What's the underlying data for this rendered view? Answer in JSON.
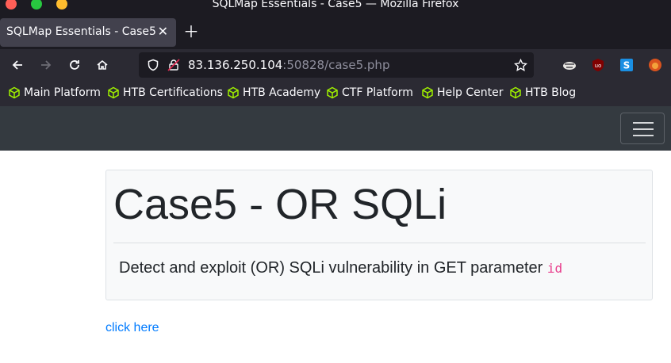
{
  "window": {
    "title": "SQLMap Essentials - Case5 — Mozilla Firefox"
  },
  "tabs": [
    {
      "label": "SQLMap Essentials - Case5"
    }
  ],
  "toolbar": {
    "url_host": "83.136.250.104",
    "url_rest": ":50828/case5.php"
  },
  "bookmarks": [
    {
      "label": "Main Platform"
    },
    {
      "label": "HTB Certifications"
    },
    {
      "label": "HTB Academy"
    },
    {
      "label": "CTF Platform"
    },
    {
      "label": "Help Center"
    },
    {
      "label": "HTB Blog"
    }
  ],
  "page": {
    "heading": "Case5 - OR SQLi",
    "lead_text": "Detect and exploit (OR) SQLi vulnerability in GET parameter ",
    "param": "id",
    "link_text": "click here"
  },
  "colors": {
    "bookmark_icon": "#9fef00",
    "link": "#007bff",
    "code": "#e83e8c"
  }
}
